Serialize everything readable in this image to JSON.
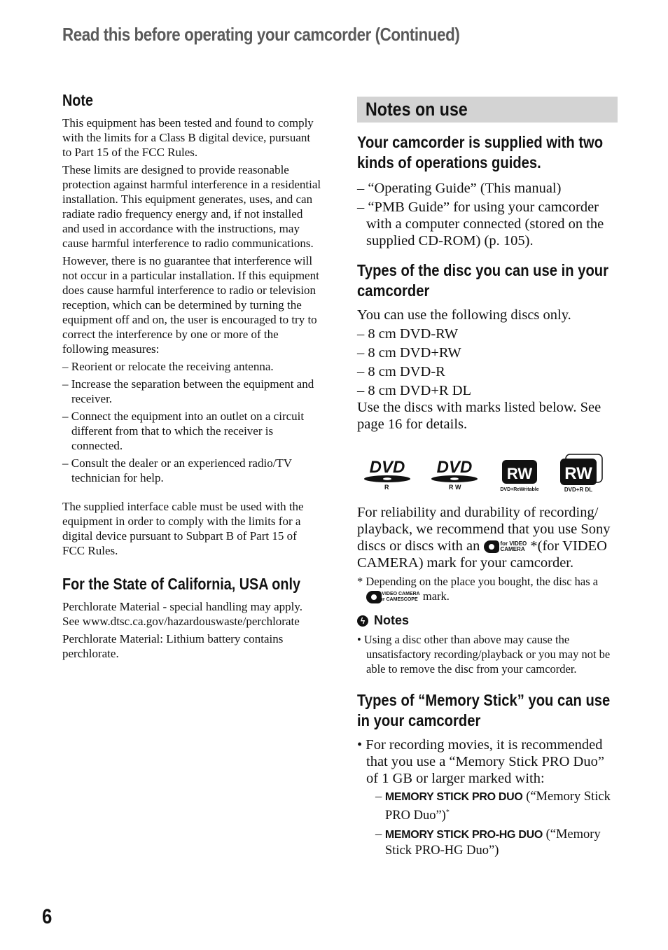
{
  "header": {
    "title": "Read this before operating your camcorder (Continued)"
  },
  "left": {
    "note_heading": "Note",
    "note_paragraphs": [
      "This equipment has been tested and found to comply with the limits for a Class B digital device, pursuant to Part 15 of the FCC Rules.",
      "These limits are designed to provide reasonable protection against harmful interference in a residential installation. This equipment generates, uses, and can radiate radio frequency energy and, if not installed and used in accordance with the instructions, may cause harmful interference to radio communications.",
      "However, there is no guarantee that interference will not occur in a particular installation. If this equipment does cause harmful interference to radio or television reception, which can be determined by turning the equipment off and on, the user is encouraged to try to correct the interference by one or more of the following measures:"
    ],
    "measures": [
      "– Reorient or relocate the receiving antenna.",
      "– Increase the separation between the equipment and receiver.",
      "– Connect the equipment into an outlet on a circuit different from that to which the receiver is connected.",
      "– Consult the dealer or an experienced radio/TV technician for help."
    ],
    "cable_paragraph": "The supplied interface cable must be used with the equipment in order to comply with the limits for a digital device pursuant to Subpart B of Part 15 of FCC Rules.",
    "california_heading": "For the State of California, USA only",
    "california_paragraphs": [
      "Perchlorate Material - special handling may apply. See www.dtsc.ca.gov/hazardouswaste/perchlorate",
      "Perchlorate Material: Lithium battery contains perchlorate."
    ]
  },
  "right": {
    "section_title": "Notes on use",
    "guides_heading": "Your camcorder is supplied with two kinds of operations guides.",
    "guides": [
      "– “Operating Guide” (This manual)",
      "– “PMB Guide” for using your camcorder with a computer connected (stored on the supplied CD-ROM) (p. 105)."
    ],
    "disc_heading": "Types of the disc you can use in your camcorder",
    "disc_intro": "You can use the following discs only.",
    "discs": [
      "– 8 cm DVD-RW",
      "– 8 cm DVD+RW",
      "– 8 cm DVD-R",
      "– 8 cm DVD+R DL"
    ],
    "disc_outro": "Use the discs with marks listed below. See page 16 for details.",
    "logos": [
      {
        "icon": "dvd-r-logo-icon",
        "main": "DVD",
        "sub": "R"
      },
      {
        "icon": "dvd-rw-logo-icon",
        "main": "DVD",
        "sub": "R W"
      },
      {
        "icon": "dvd-plus-rw-logo-icon",
        "main": "RW",
        "sub": "DVD+ReWritable"
      },
      {
        "icon": "dvd-plus-r-dl-logo-icon",
        "main": "RW",
        "sub": "DVD+R DL"
      }
    ],
    "reliability_before": "For reliability and durability of recording/ playback, we recommend that you use Sony discs or discs with an",
    "mark_text_1": "for VIDEO",
    "mark_text_2": "CAMERA",
    "reliability_after": "*(for VIDEO CAMERA) mark for your camcorder.",
    "footnote_star": "*",
    "footnote_before": "Depending on the place you bought, the disc has a",
    "footnote_mark_1": "for VIDEO CAMERA",
    "footnote_mark_2": "pour CAMESCOPE",
    "footnote_after": "mark.",
    "notes_label": "Notes",
    "notes": [
      "• Using a disc other than above may cause the unsatisfactory recording/playback or you may not be able to remove the disc from your camcorder."
    ],
    "ms_heading": "Types of “Memory Stick” you can use in your camcorder",
    "ms_bullet": "• For recording movies, it is recommended that you use a “Memory Stick PRO Duo” of 1 GB or larger marked with:",
    "ms_items": [
      {
        "logo": "MEMORY STICK PRO DUO",
        "text": "(“Memory Stick PRO Duo”)",
        "sup": "*"
      },
      {
        "logo": "MEMORY STICK PRO-HG DUO",
        "text": "(“Memory Stick PRO-HG Duo”)",
        "sup": ""
      }
    ]
  },
  "page_number": "6"
}
